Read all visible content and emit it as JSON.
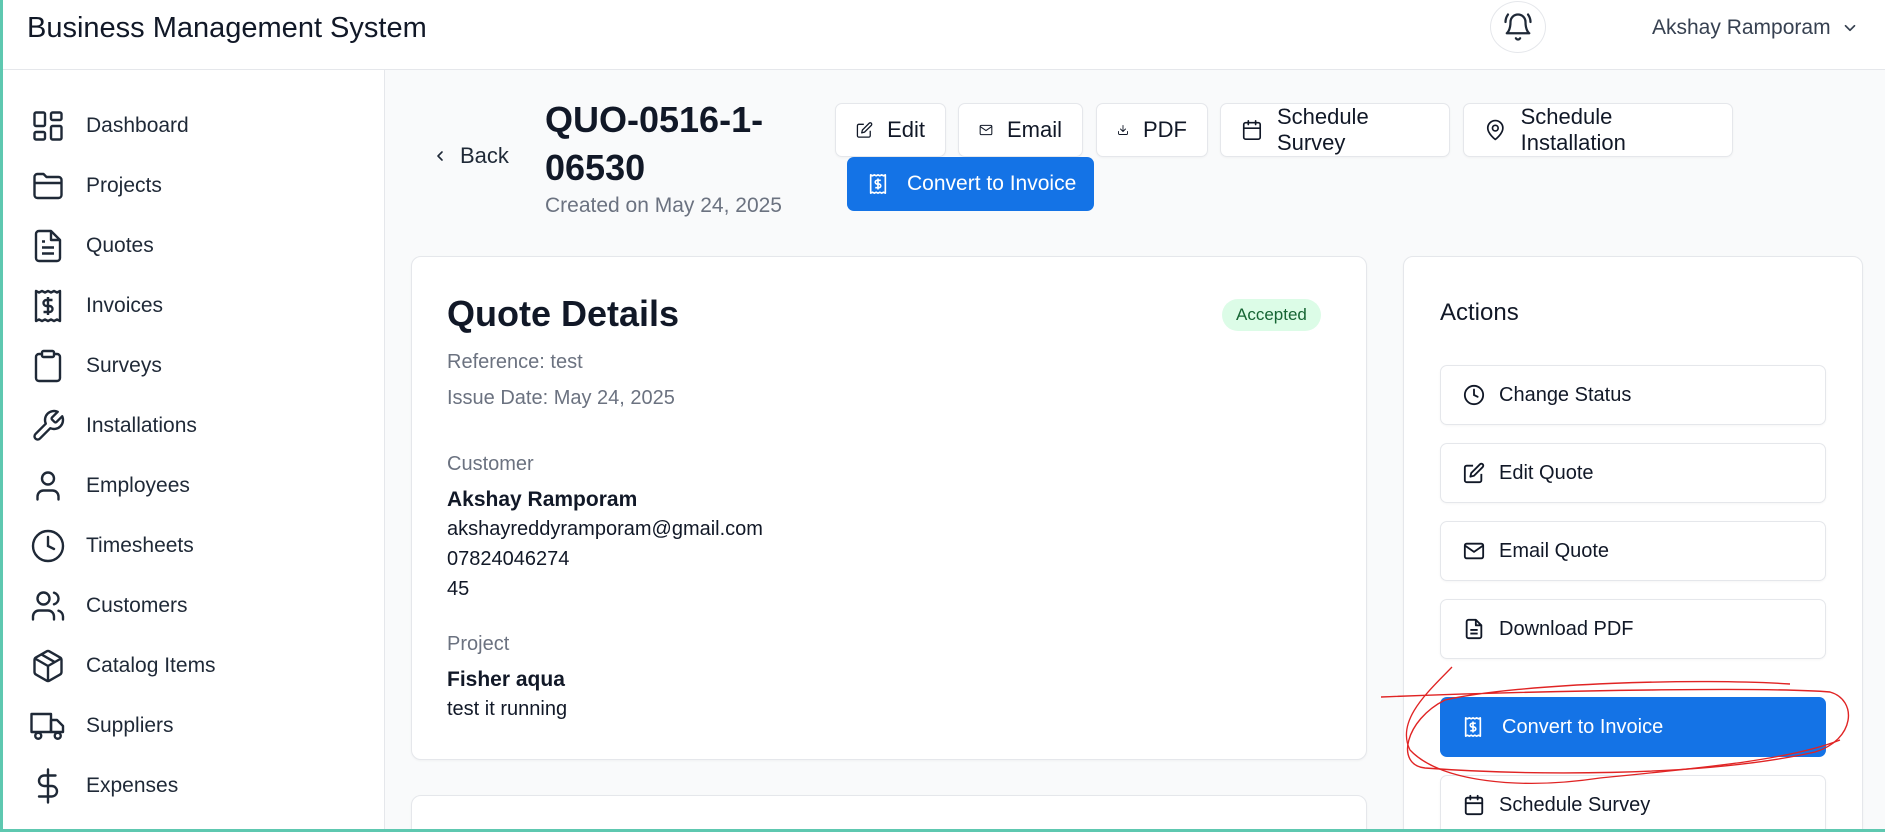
{
  "app": {
    "title": "Business Management System"
  },
  "header": {
    "user_name": "Akshay Ramporam"
  },
  "sidebar": {
    "items": [
      {
        "label": "Dashboard",
        "icon": "dashboard-icon"
      },
      {
        "label": "Projects",
        "icon": "folder-icon"
      },
      {
        "label": "Quotes",
        "icon": "file-text-icon"
      },
      {
        "label": "Invoices",
        "icon": "receipt-icon"
      },
      {
        "label": "Surveys",
        "icon": "clipboard-icon"
      },
      {
        "label": "Installations",
        "icon": "wrench-icon"
      },
      {
        "label": "Employees",
        "icon": "user-icon"
      },
      {
        "label": "Timesheets",
        "icon": "clock-icon"
      },
      {
        "label": "Customers",
        "icon": "users-icon"
      },
      {
        "label": "Catalog Items",
        "icon": "package-icon"
      },
      {
        "label": "Suppliers",
        "icon": "truck-icon"
      },
      {
        "label": "Expenses",
        "icon": "dollar-icon"
      }
    ]
  },
  "page": {
    "back_label": "Back",
    "quote_number": "QUO-0516-1-06530",
    "created_on": "Created on May 24, 2025",
    "buttons": {
      "edit": "Edit",
      "email": "Email",
      "pdf": "PDF",
      "schedule_survey": "Schedule Survey",
      "schedule_installation": "Schedule Installation",
      "convert_to_invoice": "Convert to Invoice"
    }
  },
  "details": {
    "title": "Quote Details",
    "status": "Accepted",
    "reference": "Reference: test",
    "issue_date": "Issue Date: May 24, 2025",
    "customer_label": "Customer",
    "customer_name": "Akshay Ramporam",
    "customer_email": "akshayreddyramporam@gmail.com",
    "customer_phone": "07824046274",
    "customer_address": "45",
    "project_label": "Project",
    "project_name": "Fisher aqua",
    "project_description": "test it running"
  },
  "actions": {
    "title": "Actions",
    "change_status": "Change Status",
    "edit_quote": "Edit Quote",
    "email_quote": "Email Quote",
    "download_pdf": "Download PDF",
    "convert_to_invoice": "Convert to Invoice",
    "schedule_survey": "Schedule Survey"
  },
  "colors": {
    "primary": "#1473e6",
    "badge_bg": "#dcfce7",
    "badge_text": "#166534",
    "annotation": "#e02424",
    "frame": "#5ec8b0"
  }
}
